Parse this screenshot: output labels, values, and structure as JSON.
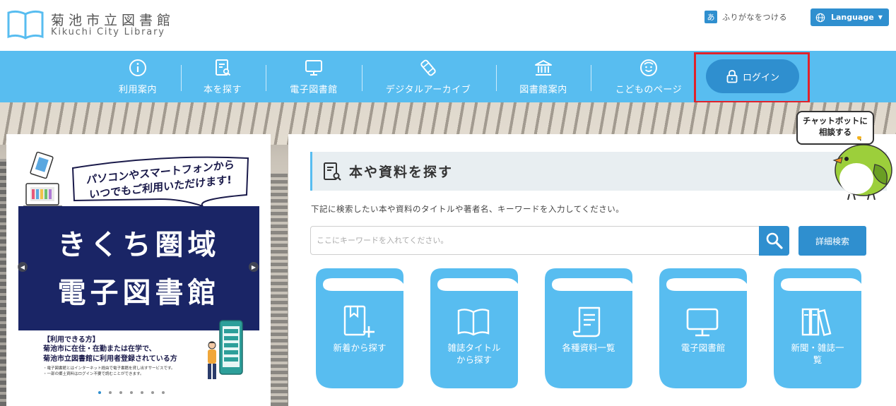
{
  "header": {
    "logo_jp": "菊池市立図書館",
    "logo_en": "Kikuchi City Library",
    "furigana_badge": "あ",
    "furigana_label": "ふりがなをつける",
    "language_label": "Language"
  },
  "nav": {
    "items": [
      {
        "label": "利用案内",
        "icon": "info-icon"
      },
      {
        "label": "本を探す",
        "icon": "book-search-icon"
      },
      {
        "label": "電子図書館",
        "icon": "monitor-icon"
      },
      {
        "label": "デジタルアーカイブ",
        "icon": "scroll-icon"
      },
      {
        "label": "図書館案内",
        "icon": "library-building-icon"
      },
      {
        "label": "こどものページ",
        "icon": "child-face-icon"
      }
    ],
    "login_label": "ログイン"
  },
  "carousel": {
    "speech_line1": "パソコンやスマートフォンから",
    "speech_line2": "いつでもご利用いただけます!",
    "banner_line1": "きくち圏域",
    "banner_line2": "電子図書館",
    "avail_title": "【利用できる方】",
    "avail_body_1": "菊池市に在住・在勤または在学で、",
    "avail_body_2": "菊池市立図書館に利用者登録されている方",
    "note_1": "・電子図書館とはインターネット経由で電子書籍を貸し出すサービスです。",
    "note_2": "・一部の郷土資料はログイン不要で読むことができます。",
    "dots_count": 7,
    "active_dot": 0
  },
  "search": {
    "title": "本や資料を探す",
    "description": "下記に検索したい本や資料のタイトルや著者名、キーワードを入力してください。",
    "placeholder": "ここにキーワードを入れてください。",
    "advanced_label": "詳細検索"
  },
  "tiles": [
    {
      "label_1": "新着から探す",
      "label_2": "",
      "icon": "new-book-icon"
    },
    {
      "label_1": "雑誌タイトル",
      "label_2": "から探す",
      "icon": "open-book-icon"
    },
    {
      "label_1": "各種資料一覧",
      "label_2": "",
      "icon": "document-list-icon"
    },
    {
      "label_1": "電子図書館",
      "label_2": "",
      "icon": "monitor-icon"
    },
    {
      "label_1": "新聞・雑誌一",
      "label_2": "覧",
      "icon": "books-icon"
    }
  ],
  "chatbot": {
    "line1": "チャットボットに",
    "line2": "相談する"
  },
  "colors": {
    "nav_bg": "#58bdf0",
    "accent": "#2f8fcf",
    "highlight_border": "#e0222b",
    "banner_bg": "#1a2566"
  }
}
